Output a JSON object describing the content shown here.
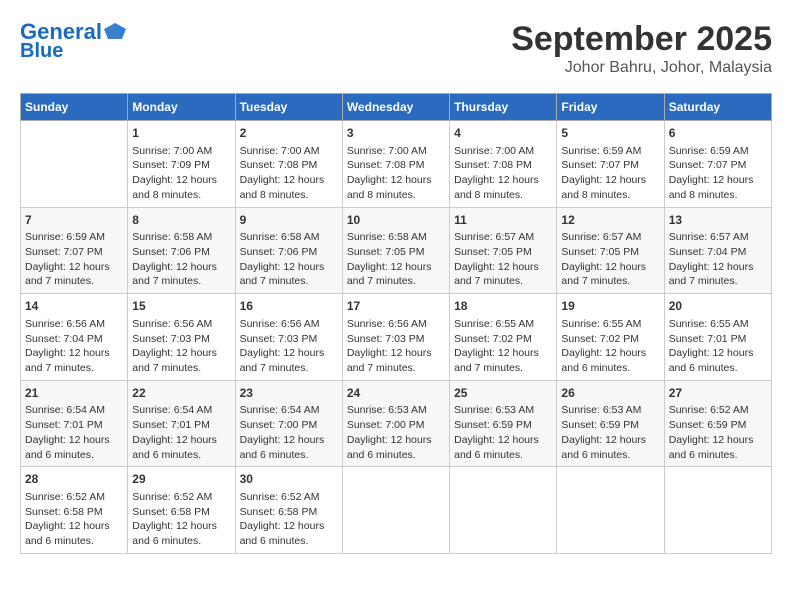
{
  "header": {
    "logo_line1": "General",
    "logo_line2": "Blue",
    "month": "September 2025",
    "location": "Johor Bahru, Johor, Malaysia"
  },
  "days_of_week": [
    "Sunday",
    "Monday",
    "Tuesday",
    "Wednesday",
    "Thursday",
    "Friday",
    "Saturday"
  ],
  "weeks": [
    [
      {
        "day": "",
        "info": ""
      },
      {
        "day": "1",
        "info": "Sunrise: 7:00 AM\nSunset: 7:09 PM\nDaylight: 12 hours\nand 8 minutes."
      },
      {
        "day": "2",
        "info": "Sunrise: 7:00 AM\nSunset: 7:08 PM\nDaylight: 12 hours\nand 8 minutes."
      },
      {
        "day": "3",
        "info": "Sunrise: 7:00 AM\nSunset: 7:08 PM\nDaylight: 12 hours\nand 8 minutes."
      },
      {
        "day": "4",
        "info": "Sunrise: 7:00 AM\nSunset: 7:08 PM\nDaylight: 12 hours\nand 8 minutes."
      },
      {
        "day": "5",
        "info": "Sunrise: 6:59 AM\nSunset: 7:07 PM\nDaylight: 12 hours\nand 8 minutes."
      },
      {
        "day": "6",
        "info": "Sunrise: 6:59 AM\nSunset: 7:07 PM\nDaylight: 12 hours\nand 8 minutes."
      }
    ],
    [
      {
        "day": "7",
        "info": "Sunrise: 6:59 AM\nSunset: 7:07 PM\nDaylight: 12 hours\nand 7 minutes."
      },
      {
        "day": "8",
        "info": "Sunrise: 6:58 AM\nSunset: 7:06 PM\nDaylight: 12 hours\nand 7 minutes."
      },
      {
        "day": "9",
        "info": "Sunrise: 6:58 AM\nSunset: 7:06 PM\nDaylight: 12 hours\nand 7 minutes."
      },
      {
        "day": "10",
        "info": "Sunrise: 6:58 AM\nSunset: 7:05 PM\nDaylight: 12 hours\nand 7 minutes."
      },
      {
        "day": "11",
        "info": "Sunrise: 6:57 AM\nSunset: 7:05 PM\nDaylight: 12 hours\nand 7 minutes."
      },
      {
        "day": "12",
        "info": "Sunrise: 6:57 AM\nSunset: 7:05 PM\nDaylight: 12 hours\nand 7 minutes."
      },
      {
        "day": "13",
        "info": "Sunrise: 6:57 AM\nSunset: 7:04 PM\nDaylight: 12 hours\nand 7 minutes."
      }
    ],
    [
      {
        "day": "14",
        "info": "Sunrise: 6:56 AM\nSunset: 7:04 PM\nDaylight: 12 hours\nand 7 minutes."
      },
      {
        "day": "15",
        "info": "Sunrise: 6:56 AM\nSunset: 7:03 PM\nDaylight: 12 hours\nand 7 minutes."
      },
      {
        "day": "16",
        "info": "Sunrise: 6:56 AM\nSunset: 7:03 PM\nDaylight: 12 hours\nand 7 minutes."
      },
      {
        "day": "17",
        "info": "Sunrise: 6:56 AM\nSunset: 7:03 PM\nDaylight: 12 hours\nand 7 minutes."
      },
      {
        "day": "18",
        "info": "Sunrise: 6:55 AM\nSunset: 7:02 PM\nDaylight: 12 hours\nand 7 minutes."
      },
      {
        "day": "19",
        "info": "Sunrise: 6:55 AM\nSunset: 7:02 PM\nDaylight: 12 hours\nand 6 minutes."
      },
      {
        "day": "20",
        "info": "Sunrise: 6:55 AM\nSunset: 7:01 PM\nDaylight: 12 hours\nand 6 minutes."
      }
    ],
    [
      {
        "day": "21",
        "info": "Sunrise: 6:54 AM\nSunset: 7:01 PM\nDaylight: 12 hours\nand 6 minutes."
      },
      {
        "day": "22",
        "info": "Sunrise: 6:54 AM\nSunset: 7:01 PM\nDaylight: 12 hours\nand 6 minutes."
      },
      {
        "day": "23",
        "info": "Sunrise: 6:54 AM\nSunset: 7:00 PM\nDaylight: 12 hours\nand 6 minutes."
      },
      {
        "day": "24",
        "info": "Sunrise: 6:53 AM\nSunset: 7:00 PM\nDaylight: 12 hours\nand 6 minutes."
      },
      {
        "day": "25",
        "info": "Sunrise: 6:53 AM\nSunset: 6:59 PM\nDaylight: 12 hours\nand 6 minutes."
      },
      {
        "day": "26",
        "info": "Sunrise: 6:53 AM\nSunset: 6:59 PM\nDaylight: 12 hours\nand 6 minutes."
      },
      {
        "day": "27",
        "info": "Sunrise: 6:52 AM\nSunset: 6:59 PM\nDaylight: 12 hours\nand 6 minutes."
      }
    ],
    [
      {
        "day": "28",
        "info": "Sunrise: 6:52 AM\nSunset: 6:58 PM\nDaylight: 12 hours\nand 6 minutes."
      },
      {
        "day": "29",
        "info": "Sunrise: 6:52 AM\nSunset: 6:58 PM\nDaylight: 12 hours\nand 6 minutes."
      },
      {
        "day": "30",
        "info": "Sunrise: 6:52 AM\nSunset: 6:58 PM\nDaylight: 12 hours\nand 6 minutes."
      },
      {
        "day": "",
        "info": ""
      },
      {
        "day": "",
        "info": ""
      },
      {
        "day": "",
        "info": ""
      },
      {
        "day": "",
        "info": ""
      }
    ]
  ]
}
